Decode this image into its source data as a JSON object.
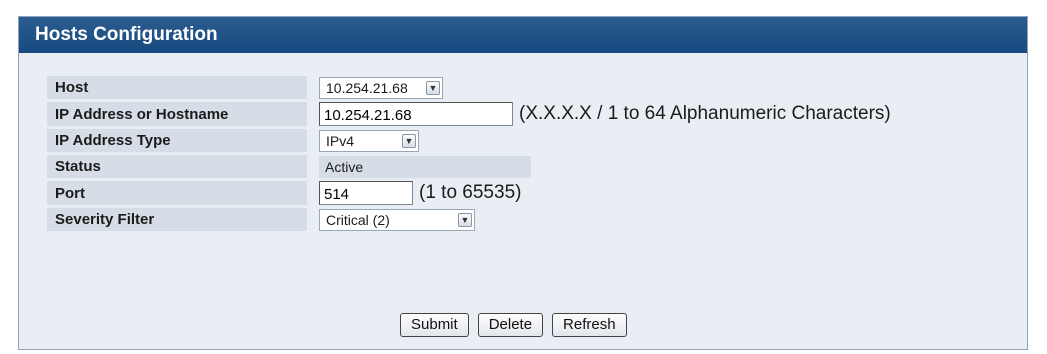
{
  "panel": {
    "title": "Hosts Configuration"
  },
  "form": {
    "host": {
      "label": "Host",
      "selected": "10.254.21.68"
    },
    "ip_address": {
      "label": "IP Address or Hostname",
      "value": "10.254.21.68",
      "hint": "(X.X.X.X / 1 to 64 Alphanumeric Characters)"
    },
    "ip_type": {
      "label": "IP Address Type",
      "selected": "IPv4"
    },
    "status": {
      "label": "Status",
      "value": "Active"
    },
    "port": {
      "label": "Port",
      "value": "514",
      "hint": "(1 to 65535)"
    },
    "severity": {
      "label": "Severity Filter",
      "selected": "Critical (2)"
    }
  },
  "buttons": {
    "submit": "Submit",
    "delete": "Delete",
    "refresh": "Refresh"
  },
  "icons": {
    "dropdown": "chevron-down-icon"
  },
  "colors": {
    "header": "#1f4f85",
    "panel_bg": "#e9eef4",
    "label_bg": "#d6dde6"
  }
}
